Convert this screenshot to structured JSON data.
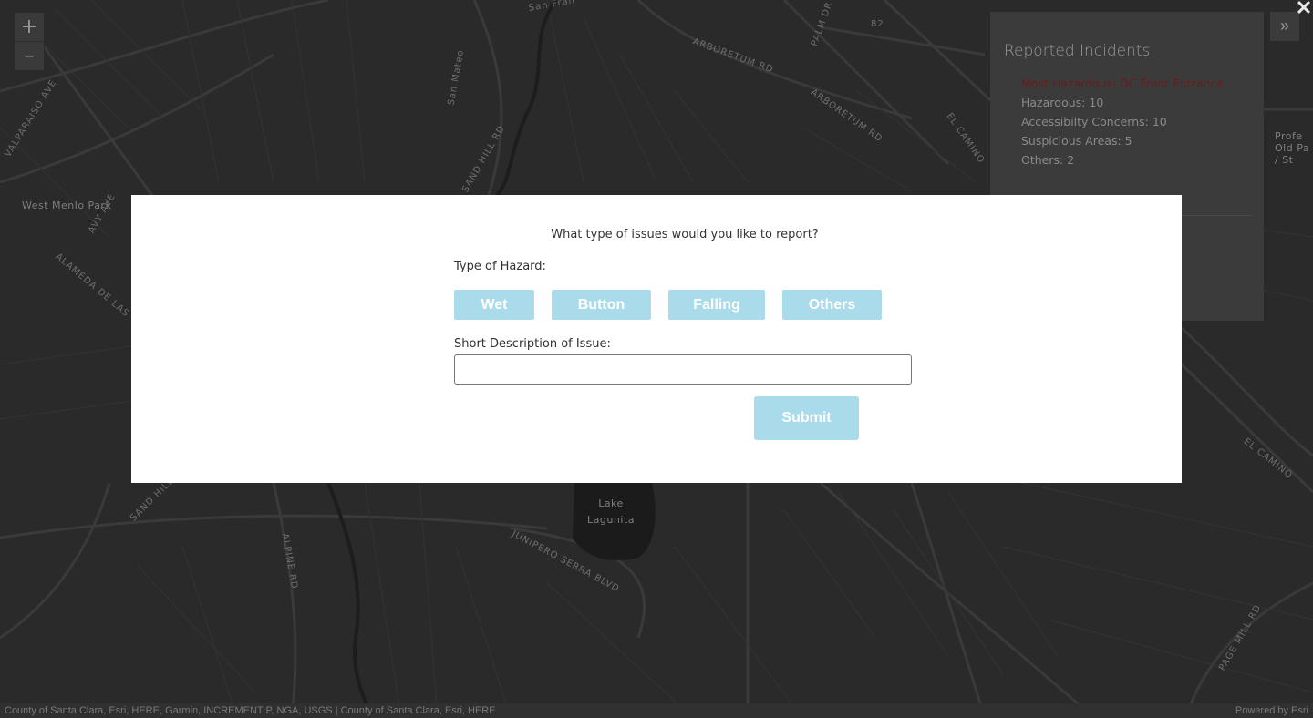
{
  "map": {
    "labels": [
      "West Menlo Park",
      "Lake Lagunita",
      "Profe Old Pa / St"
    ],
    "roads": [
      "ARBORETUM RD",
      "PALM DR",
      "EL CAMINO",
      "VALPARAISO AVE",
      "AVY AVE",
      "ALAMEDA DE LAS",
      "JUNIPERO SERRA BLVD",
      "SAND HILL RD",
      "ALPINE RD",
      "PAGE MILL RD",
      "San Fran",
      "San Mateo",
      "82"
    ]
  },
  "zoom": {
    "in": "+",
    "out": "–"
  },
  "panel": {
    "title": "Reported Incidents",
    "most_hazardous": "Most Hazardous: DC Front Entrance",
    "stats": [
      "Hazardous: 10",
      "Accessibilty Concerns: 10",
      "Suspicious Areas: 5",
      "Others: 2"
    ]
  },
  "expand": "»",
  "close": "✕",
  "attribution": {
    "left": "County of Santa Clara, Esri, HERE, Garmin, INCREMENT P, NGA, USGS | County of Santa Clara, Esri, HERE",
    "right": "Powered by Esri"
  },
  "modal": {
    "question": "What type of issues would you like to report?",
    "hazard_label": "Type of Hazard:",
    "buttons": [
      "Wet",
      "Button",
      "Falling",
      "Others"
    ],
    "description_label": "Short Description of Issue:",
    "description_value": "",
    "submit": "Submit"
  }
}
